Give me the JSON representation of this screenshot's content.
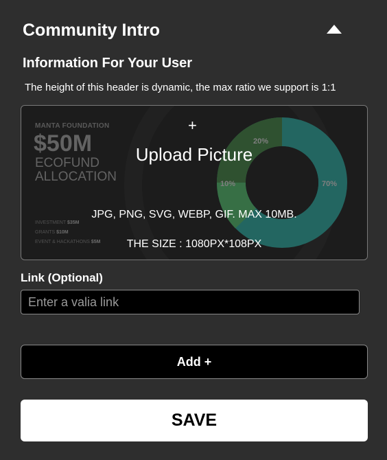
{
  "header": {
    "title": "Community Intro",
    "collapse_icon": "triangle-up-icon"
  },
  "intro": {
    "subtitle": "Information For Your User",
    "help_text": "The height of this header is dynamic, the max ratio we support is 1:1"
  },
  "upload": {
    "plus_icon": "+",
    "label": "Upload Picture",
    "formats": "JPG, PNG, SVG, WEBP, GIF. MAX 10MB.",
    "size": "THE SIZE : 1080PX*108PX",
    "preview": {
      "brand": "MANTA FOUNDATION",
      "amount": "$50M",
      "line1": "ECOFUND",
      "line2": "ALLOCATION",
      "stats": [
        {
          "label": "INVESTMENT",
          "value": "$35M"
        },
        {
          "label": "GRANTS",
          "value": "$10M"
        },
        {
          "label": "EVENT & HACKATHONS",
          "value": "$5M"
        }
      ],
      "donut_labels": {
        "a": "20%",
        "b": "10%",
        "c": "70%"
      },
      "colors": {
        "green": "#3fa36a",
        "teal": "#2aa39a",
        "dark_green": "#2f6b3a"
      }
    }
  },
  "link": {
    "label": "Link (Optional)",
    "placeholder": "Enter a valia link",
    "value": ""
  },
  "actions": {
    "add_label": "Add +",
    "save_label": "SAVE"
  }
}
